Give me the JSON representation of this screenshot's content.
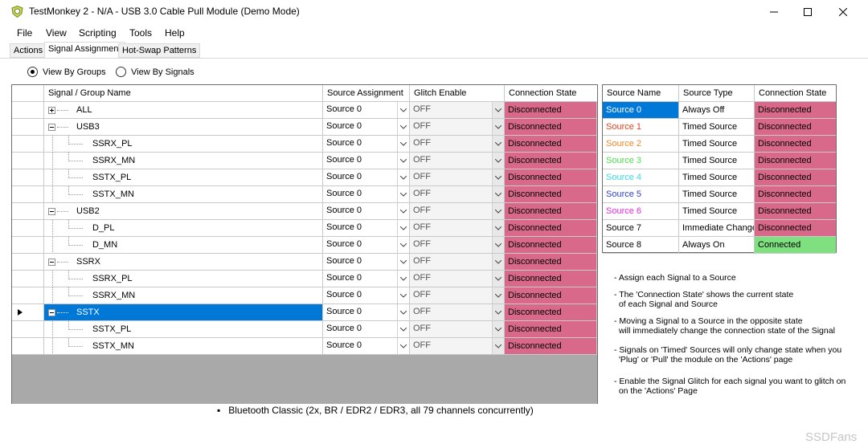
{
  "window": {
    "title": "TestMonkey 2 - N/A - USB 3.0 Cable Pull Module (Demo Mode)",
    "minimize_glyph": "—",
    "maximize_glyph": "☐",
    "close_glyph": "✕"
  },
  "menu": [
    "File",
    "View",
    "Scripting",
    "Tools",
    "Help"
  ],
  "tabs": [
    {
      "label": "Actions",
      "active": false
    },
    {
      "label": "Signal Assignment",
      "active": true
    },
    {
      "label": "Hot-Swap Patterns",
      "active": false
    }
  ],
  "view_mode": {
    "by_groups": "View By Groups",
    "by_signals": "View By Signals",
    "selected": "by_groups"
  },
  "grid": {
    "headers": [
      "Signal / Group Name",
      "Source Assignment",
      "Glitch Enable",
      "Connection State"
    ],
    "rows": [
      {
        "name": "ALL",
        "level": 0,
        "expander": "plus",
        "source": "Source 0",
        "glitch": "OFF",
        "state": "Disconnected"
      },
      {
        "name": "USB3",
        "level": 0,
        "expander": "minus",
        "source": "Source 0",
        "glitch": "OFF",
        "state": "Disconnected"
      },
      {
        "name": "SSRX_PL",
        "level": 1,
        "source": "Source 0",
        "glitch": "OFF",
        "state": "Disconnected"
      },
      {
        "name": "SSRX_MN",
        "level": 1,
        "source": "Source 0",
        "glitch": "OFF",
        "state": "Disconnected"
      },
      {
        "name": "SSTX_PL",
        "level": 1,
        "source": "Source 0",
        "glitch": "OFF",
        "state": "Disconnected"
      },
      {
        "name": "SSTX_MN",
        "level": 1,
        "source": "Source 0",
        "glitch": "OFF",
        "state": "Disconnected"
      },
      {
        "name": "USB2",
        "level": 0,
        "expander": "minus",
        "source": "Source 0",
        "glitch": "OFF",
        "state": "Disconnected"
      },
      {
        "name": "D_PL",
        "level": 1,
        "source": "Source 0",
        "glitch": "OFF",
        "state": "Disconnected"
      },
      {
        "name": "D_MN",
        "level": 1,
        "source": "Source 0",
        "glitch": "OFF",
        "state": "Disconnected"
      },
      {
        "name": "SSRX",
        "level": 0,
        "expander": "minus",
        "source": "Source 0",
        "glitch": "OFF",
        "state": "Disconnected"
      },
      {
        "name": "SSRX_PL",
        "level": 1,
        "source": "Source 0",
        "glitch": "OFF",
        "state": "Disconnected"
      },
      {
        "name": "SSRX_MN",
        "level": 1,
        "source": "Source 0",
        "glitch": "OFF",
        "state": "Disconnected"
      },
      {
        "name": "SSTX",
        "level": 0,
        "expander": "minus",
        "selected": true,
        "source": "Source 0",
        "glitch": "OFF",
        "state": "Disconnected"
      },
      {
        "name": "SSTX_PL",
        "level": 1,
        "source": "Source 0",
        "glitch": "OFF",
        "state": "Disconnected"
      },
      {
        "name": "SSTX_MN",
        "level": 1,
        "source": "Source 0",
        "glitch": "OFF",
        "state": "Disconnected"
      }
    ]
  },
  "sources": {
    "headers": [
      "Source Name",
      "Source Type",
      "Connection State"
    ],
    "rows": [
      {
        "name": "Source 0",
        "color": "#ffffff",
        "selected": true,
        "type": "Always Off",
        "state": "Disconnected"
      },
      {
        "name": "Source 1",
        "color": "#e8401c",
        "type": "Timed Source",
        "state": "Disconnected"
      },
      {
        "name": "Source 2",
        "color": "#f08a2a",
        "type": "Timed Source",
        "state": "Disconnected"
      },
      {
        "name": "Source 3",
        "color": "#4ce04c",
        "type": "Timed Source",
        "state": "Disconnected"
      },
      {
        "name": "Source 4",
        "color": "#3fd7e6",
        "type": "Timed Source",
        "state": "Disconnected"
      },
      {
        "name": "Source 5",
        "color": "#2d3fd8",
        "type": "Timed Source",
        "state": "Disconnected"
      },
      {
        "name": "Source 6",
        "color": "#e52ae5",
        "type": "Timed Source",
        "state": "Disconnected"
      },
      {
        "name": "Source 7",
        "color": "#000000",
        "type": "Immediate Change",
        "state": "Disconnected"
      },
      {
        "name": "Source 8",
        "color": "#000000",
        "type": "Always On",
        "state": "Connected"
      }
    ]
  },
  "notes": [
    "- Assign each Signal to a Source",
    "- The 'Connection State' shows the current state\n  of each Signal and Source",
    "- Moving a Signal to a Source in the opposite state\n  will immediately change the connection state of the Signal",
    "- Signals on 'Timed' Sources will only change state when you\n  'Plug' or 'Pull' the module on the 'Actions' page",
    "- Enable the Signal Glitch for each signal you want to glitch on\n  on the 'Actions' Page"
  ],
  "colors": {
    "disconnected": "#d9698b",
    "connected": "#7fe07f",
    "selection": "#0078d7",
    "grid_empty": "#a9a9a9"
  },
  "background_text": "Bluetooth Classic (2x, BR / EDR2 / EDR3, all 79 channels concurrently)",
  "watermark": "SSDFans",
  "icons": {
    "app": "monkey-shield-icon",
    "dropdown": "chevron-down-icon",
    "row_pointer": "triangle-right-icon"
  }
}
